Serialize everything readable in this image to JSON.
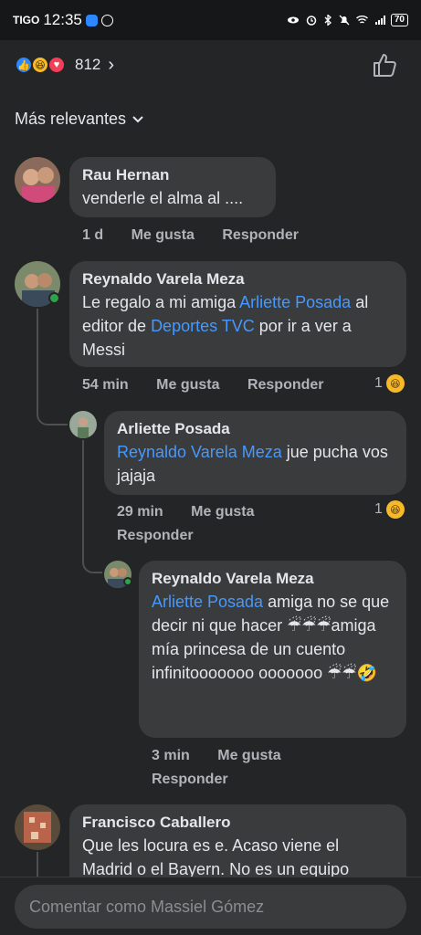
{
  "status_bar": {
    "carrier": "TIGO",
    "time": "12:35",
    "battery": "70"
  },
  "reactions": {
    "count": "812",
    "types": [
      "like",
      "haha",
      "love"
    ]
  },
  "sort": {
    "label": "Más relevantes"
  },
  "comments": [
    {
      "author": "Rau Hernan",
      "text": "venderle el alma al ....",
      "time": "1 d",
      "like": "Me gusta",
      "reply": "Responder"
    },
    {
      "author": "Reynaldo Varela Meza",
      "text_pre": "Le regalo a mi amiga ",
      "mention1": "Arliette Posada",
      "text_mid": " al editor de ",
      "mention2": "Deportes TVC",
      "text_post": " por ir a ver a Messi",
      "time": "54 min",
      "like": "Me gusta",
      "reply": "Responder",
      "reaction_count": "1"
    },
    {
      "author": "Arliette Posada",
      "mention": "Reynaldo Varela Meza",
      "text": " jue pucha vos jajaja",
      "time": "29 min",
      "like": "Me gusta",
      "reply": "Responder",
      "reaction_count": "1"
    },
    {
      "author": "Reynaldo Varela Meza",
      "mention": "Arliette Posada",
      "text": " amiga no se que decir ni que hacer ☔☔☔amiga mía princesa de un cuento infinitooooooo ooooooo ☔☔🤣",
      "time": "3 min",
      "like": "Me gusta",
      "reply": "Responder"
    },
    {
      "author": "Francisco Caballero",
      "text": "Que les locura es e. Acaso viene el Madrid o el Bayern. No es un equipo"
    }
  ],
  "composer": {
    "placeholder": "Comentar como Massiel Gómez"
  }
}
